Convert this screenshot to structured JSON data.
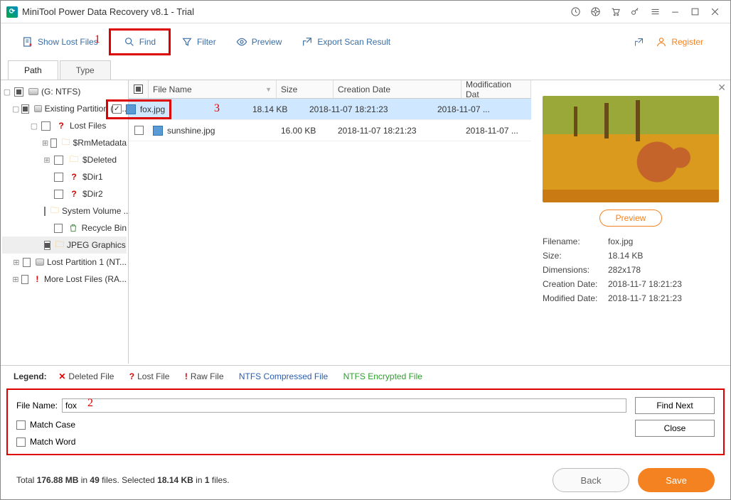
{
  "window": {
    "title": "MiniTool Power Data Recovery v8.1 - Trial"
  },
  "toolbar": {
    "show_lost": "Show Lost Files",
    "find": "Find",
    "filter": "Filter",
    "preview": "Preview",
    "export": "Export Scan Result",
    "register": "Register"
  },
  "markers": {
    "m1": "1",
    "m2": "2",
    "m3": "3"
  },
  "tabs": {
    "path": "Path",
    "type": "Type"
  },
  "tree": {
    "root": "(G: NTFS)",
    "existing": "Existing Partition (N...",
    "lostfiles": "Lost Files",
    "rm": "$RmMetadata",
    "deleted": "$Deleted",
    "dir1": "$Dir1",
    "dir2": "$Dir2",
    "sysvol": "System Volume ...",
    "recycle": "Recycle Bin",
    "jpeg": "JPEG Graphics ...",
    "lostpart": "Lost Partition 1 (NT...",
    "more": "More Lost Files (RA..."
  },
  "columns": {
    "name": "File Name",
    "size": "Size",
    "cd": "Creation Date",
    "md": "Modification Dat"
  },
  "files": [
    {
      "name": "fox.jpg",
      "size": "18.14 KB",
      "cd": "2018-11-07 18:21:23",
      "md": "2018-11-07 ...",
      "checked": true,
      "selected": true
    },
    {
      "name": "sunshine.jpg",
      "size": "16.00 KB",
      "cd": "2018-11-07 18:21:23",
      "md": "2018-11-07 ...",
      "checked": false,
      "selected": false
    }
  ],
  "preview": {
    "btn": "Preview",
    "labels": {
      "fn": "Filename:",
      "sz": "Size:",
      "dim": "Dimensions:",
      "cd": "Creation Date:",
      "md": "Modified Date:"
    },
    "values": {
      "fn": "fox.jpg",
      "sz": "18.14 KB",
      "dim": "282x178",
      "cd": "2018-11-7 18:21:23",
      "md": "2018-11-7 18:21:23"
    }
  },
  "legend": {
    "label": "Legend:",
    "deleted": "Deleted File",
    "lost": "Lost File",
    "raw": "Raw File",
    "ntfs_c": "NTFS Compressed File",
    "ntfs_e": "NTFS Encrypted File"
  },
  "find": {
    "label": "File Name:",
    "value": "fox",
    "match_case": "Match Case",
    "match_word": "Match Word",
    "find_next": "Find Next",
    "close": "Close"
  },
  "footer": {
    "total_a": "Total ",
    "total_b": "176.88 MB",
    "total_c": " in ",
    "total_d": "49",
    "total_e": " files.  Selected ",
    "sel_a": "18.14 KB",
    "sel_b": " in ",
    "sel_c": "1",
    "sel_d": " files.",
    "back": "Back",
    "save": "Save"
  }
}
